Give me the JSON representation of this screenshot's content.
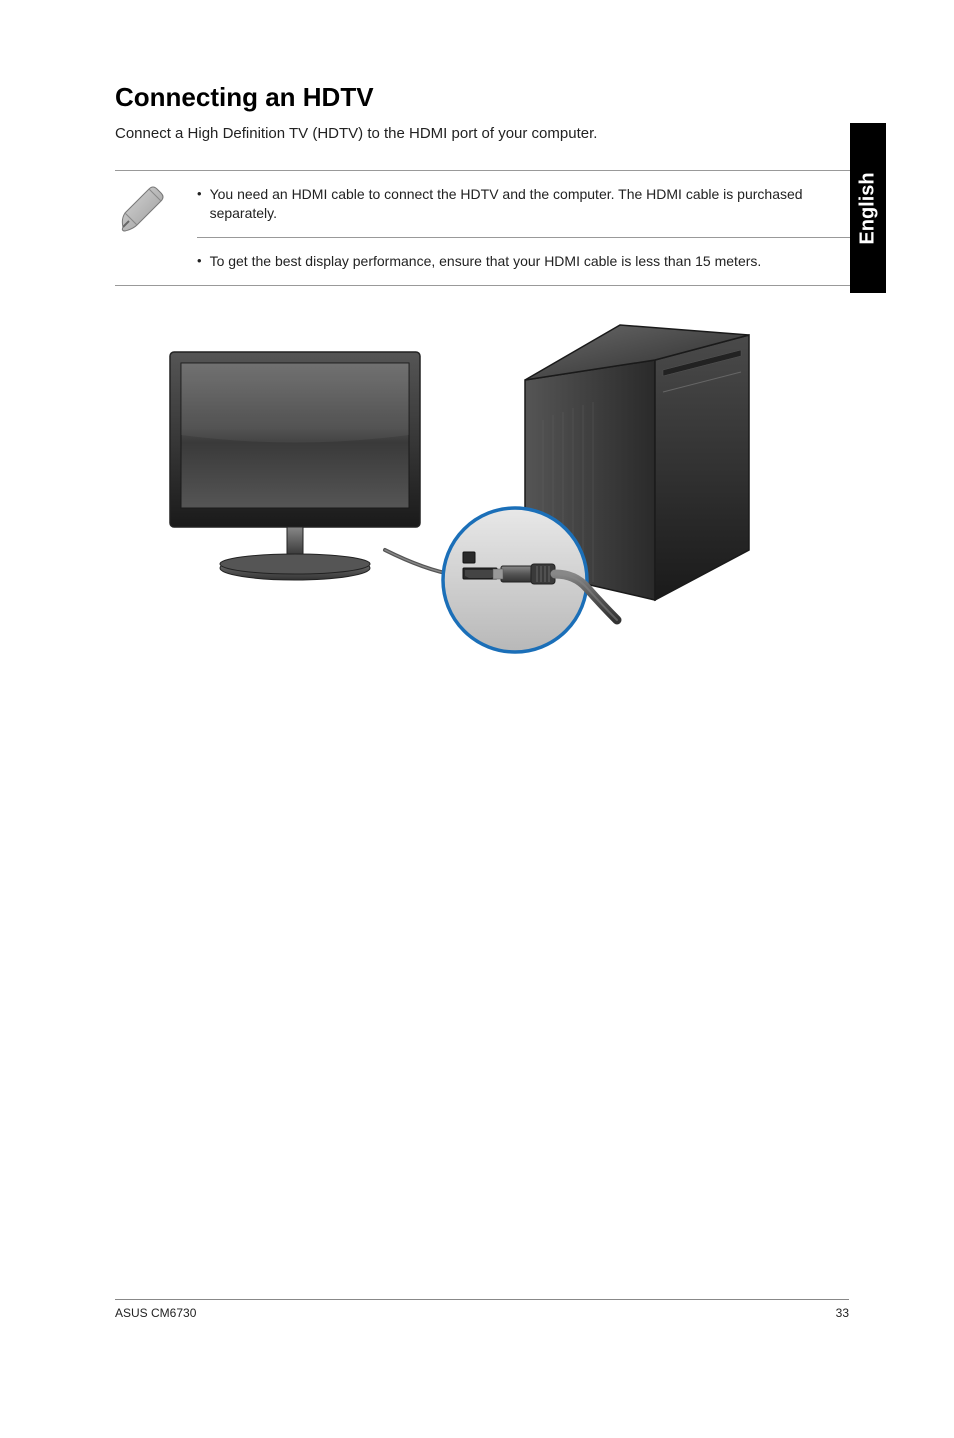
{
  "heading": "Connecting an HDTV",
  "intro": "Connect a High Definition TV (HDTV) to the HDMI port of your computer.",
  "notes": [
    "You need an HDMI cable to connect the HDTV and the computer. The HDMI cable is purchased separately.",
    "To get the best display performance, ensure that your HDMI cable is less than 15 meters."
  ],
  "side_tab": "English",
  "footer": {
    "product": "ASUS CM6730",
    "page_number": "33"
  }
}
